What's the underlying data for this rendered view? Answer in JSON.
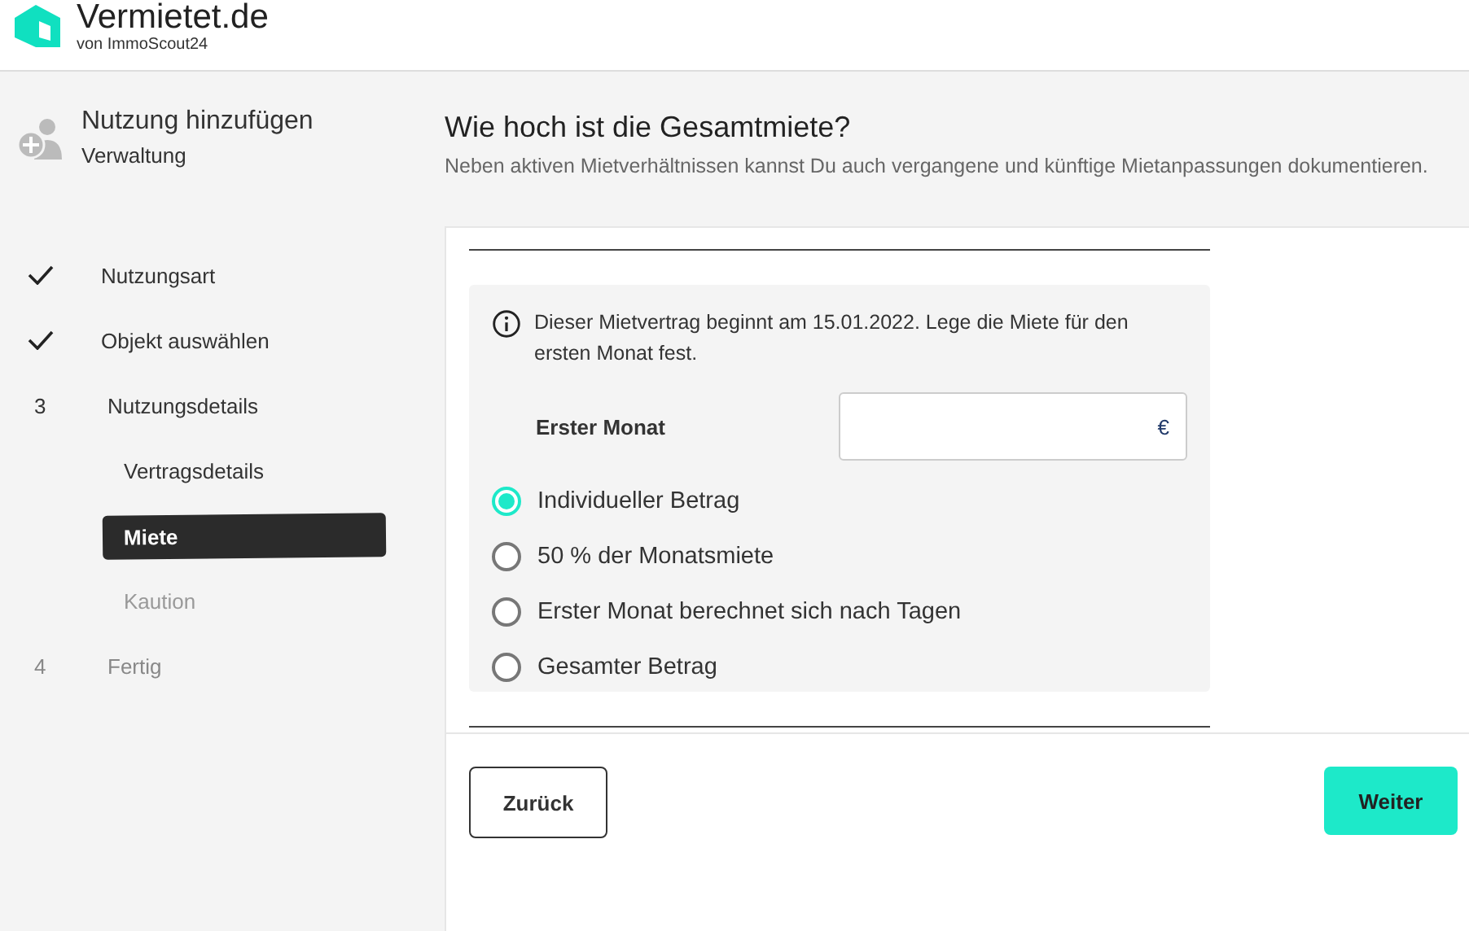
{
  "header": {
    "brand": "Vermietet.de",
    "tagline": "von ImmoScout24"
  },
  "sidebar": {
    "title": "Nutzung hinzufügen",
    "subtitle": "Verwaltung",
    "steps": [
      {
        "kind": "done",
        "label": "Nutzungsart",
        "active": true
      },
      {
        "kind": "done",
        "label": "Objekt auswählen",
        "active": true
      },
      {
        "kind": "number",
        "number": "3",
        "label": "Nutzungsdetails",
        "active": true,
        "children": [
          {
            "label": "Vertragsdetails",
            "active": true,
            "selected": false
          },
          {
            "label": "Miete",
            "active": true,
            "selected": true
          },
          {
            "label": "Kaution",
            "active": false,
            "selected": false
          }
        ]
      },
      {
        "kind": "number",
        "number": "4",
        "label": "Fertig",
        "active": false
      }
    ]
  },
  "main": {
    "title": "Wie hoch ist die Gesamtmiete?",
    "subtitle": "Neben aktiven Mietverhältnissen kannst Du auch vergangene und künftige Mietanpassungen dokumentieren.",
    "info": "Dieser Mietvertrag beginnt am 15.01.2022. Lege die Miete für den ersten Monat fest.",
    "field": {
      "label": "Erster Monat",
      "unit": "€"
    },
    "options": [
      {
        "label": "Individueller Betrag",
        "selected": true
      },
      {
        "label": "50 % der Monatsmiete",
        "selected": false
      },
      {
        "label": "Erster Monat berechnet sich nach Tagen",
        "selected": false
      },
      {
        "label": "Gesamter Betrag",
        "selected": false
      }
    ]
  },
  "buttons": {
    "back": "Zurück",
    "next": "Weiter"
  }
}
